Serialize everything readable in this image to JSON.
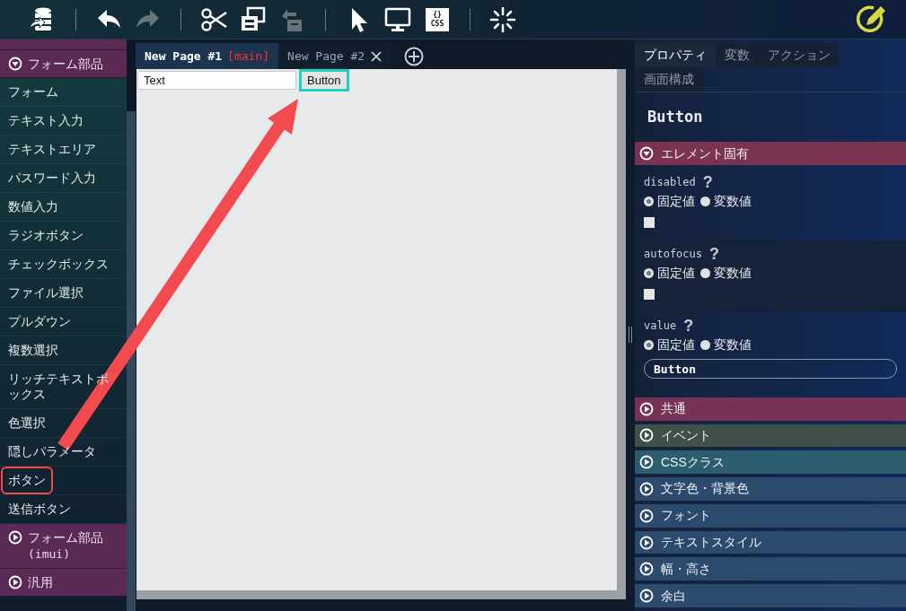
{
  "toolbar": {
    "buttons": [
      {
        "kind": "database",
        "disabled": false
      },
      {
        "kind": "separator"
      },
      {
        "kind": "undo",
        "disabled": false
      },
      {
        "kind": "redo",
        "disabled": true
      },
      {
        "kind": "separator"
      },
      {
        "kind": "cut",
        "disabled": false
      },
      {
        "kind": "copy",
        "disabled": false
      },
      {
        "kind": "paste",
        "disabled": true
      },
      {
        "kind": "separator"
      },
      {
        "kind": "pointer",
        "disabled": false
      },
      {
        "kind": "monitor",
        "disabled": false
      },
      {
        "kind": "css",
        "disabled": false,
        "braces": "{}",
        "label": "CSS"
      },
      {
        "kind": "separator"
      },
      {
        "kind": "burst",
        "disabled": false
      }
    ],
    "edit_button": {
      "kind": "pencil"
    }
  },
  "sidebar": {
    "categories": [
      {
        "label": "フォーム部品",
        "expanded": true,
        "items": [
          {
            "label": "フォーム",
            "highlighted": false
          },
          {
            "label": "テキスト入力",
            "highlighted": false
          },
          {
            "label": "テキストエリア",
            "highlighted": false
          },
          {
            "label": "パスワード入力",
            "highlighted": false
          },
          {
            "label": "数値入力",
            "highlighted": false
          },
          {
            "label": "ラジオボタン",
            "highlighted": false
          },
          {
            "label": "チェックボックス",
            "highlighted": false
          },
          {
            "label": "ファイル選択",
            "highlighted": false
          },
          {
            "label": "プルダウン",
            "highlighted": false
          },
          {
            "label": "複数選択",
            "highlighted": false
          },
          {
            "label": "リッチテキストボックス",
            "highlighted": false
          },
          {
            "label": "色選択",
            "highlighted": false
          },
          {
            "label": "隠しパラメータ",
            "highlighted": false
          },
          {
            "label": "ボタン",
            "highlighted": true
          },
          {
            "label": "送信ボタン",
            "highlighted": false
          }
        ]
      },
      {
        "label": "フォーム部品",
        "sub": "(imui)",
        "expanded": false
      },
      {
        "label": "汎用",
        "expanded": false
      }
    ]
  },
  "page_tabs": [
    {
      "label": "New Page #1",
      "tag": "[main]",
      "selected": true,
      "closable": false
    },
    {
      "label": "New Page #2",
      "selected": false,
      "closable": true
    }
  ],
  "canvas": {
    "elements": [
      {
        "kind": "text_input",
        "value": "Text",
        "selected": false
      },
      {
        "kind": "button",
        "label": "Button",
        "selected": true
      }
    ]
  },
  "properties_panel": {
    "tabs": [
      {
        "label": "プロパティ",
        "selected": true
      },
      {
        "label": "変数",
        "selected": false
      },
      {
        "label": "アクション",
        "selected": false
      },
      {
        "label": "画面構成",
        "selected": false
      }
    ],
    "title": "Button",
    "sections": [
      {
        "label": "エレメント固有",
        "expanded": true,
        "color": "#7a3350",
        "properties": [
          {
            "name": "disabled",
            "help": "?",
            "options": [
              {
                "label": "固定値",
                "selected": true
              },
              {
                "label": "変数値",
                "selected": false
              }
            ],
            "kind": "checkbox",
            "checked": false
          },
          {
            "name": "autofocus",
            "help": "?",
            "options": [
              {
                "label": "固定値",
                "selected": true
              },
              {
                "label": "変数値",
                "selected": false
              }
            ],
            "kind": "checkbox",
            "checked": false
          },
          {
            "name": "value",
            "help": "?",
            "options": [
              {
                "label": "固定値",
                "selected": true
              },
              {
                "label": "変数値",
                "selected": false
              }
            ],
            "kind": "text",
            "value": "Button"
          }
        ]
      },
      {
        "label": "共通",
        "expanded": false,
        "color": "#763257"
      },
      {
        "label": "イベント",
        "expanded": false,
        "color": "#3f5148"
      },
      {
        "label": "CSSクラス",
        "expanded": false,
        "color": "#2b5d6e"
      },
      {
        "label": "文字色・背景色",
        "expanded": false,
        "color": "#2c4a6e"
      },
      {
        "label": "フォント",
        "expanded": false,
        "color": "#2c4a6e"
      },
      {
        "label": "テキストスタイル",
        "expanded": false,
        "color": "#2c4a6e"
      },
      {
        "label": "幅・高さ",
        "expanded": false,
        "color": "#2c4a6e"
      },
      {
        "label": "余白",
        "expanded": false,
        "color": "#2c4a6e"
      }
    ]
  }
}
